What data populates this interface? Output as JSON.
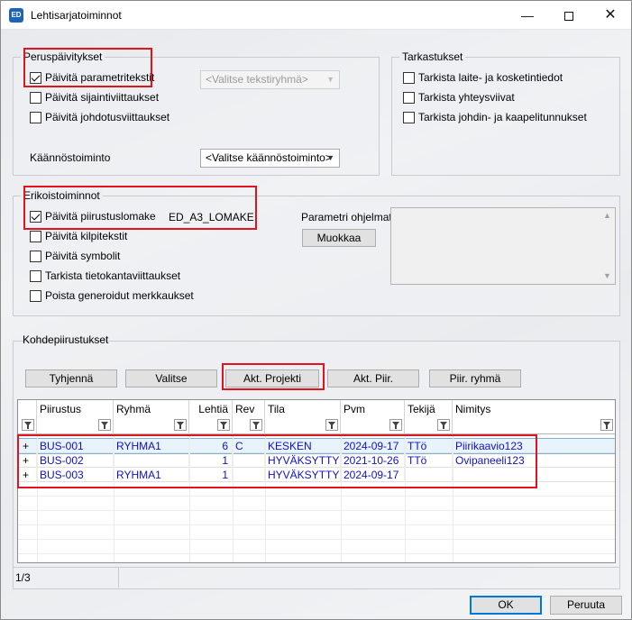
{
  "window": {
    "title": "Lehtisarjatoiminnot",
    "app_icon": "ED",
    "controls": {
      "minimize": "—",
      "close": "✕"
    }
  },
  "basic": {
    "label": "Peruspäivitykset",
    "items": [
      {
        "label": "Päivitä parametritekstit",
        "checked": true
      },
      {
        "label": "Päivitä sijaintiviittaukset",
        "checked": false
      },
      {
        "label": "Päivitä johdotusviittaukset",
        "checked": false
      }
    ],
    "text_group_select": "<Valitse tekstiryhmä>",
    "translation_label": "Käännöstoiminto",
    "translation_select": "<Valitse käännöstoiminto>"
  },
  "checks": {
    "label": "Tarkastukset",
    "items": [
      {
        "label": "Tarkista laite- ja kosketintiedot",
        "checked": false
      },
      {
        "label": "Tarkista yhteysviivat",
        "checked": false
      },
      {
        "label": "Tarkista johdin- ja kaapelitunnukset",
        "checked": false
      }
    ]
  },
  "special": {
    "label": "Erikoistoiminnot",
    "items": [
      {
        "label": "Päivitä piirustuslomake",
        "checked": true
      },
      {
        "label": "Päivitä kilpitekstit",
        "checked": false
      },
      {
        "label": "Päivitä symbolit",
        "checked": false
      },
      {
        "label": "Tarkista tietokantaviittaukset",
        "checked": false
      },
      {
        "label": "Poista generoidut merkkaukset",
        "checked": false
      }
    ],
    "form_name": "ED_A3_LOMAKE",
    "param_programs_label": "Parametri ohjelmat:",
    "edit_button": "Muokkaa"
  },
  "targets": {
    "label": "Kohdepiirustukset",
    "buttons": {
      "clear": "Tyhjennä",
      "select": "Valitse",
      "active_project": "Akt. Projekti",
      "active_drawing": "Akt. Piir.",
      "drawing_group": "Piir. ryhmä"
    },
    "columns": [
      "Piirustus",
      "Ryhmä",
      "Lehtiä",
      "Rev",
      "Tila",
      "Pvm",
      "Tekijä",
      "Nimitys"
    ],
    "rows": [
      {
        "marker": "+",
        "drawing": "BUS-001",
        "group": "RYHMA1",
        "sheets": "6",
        "rev": "C",
        "state": "KESKEN",
        "date": "2024-09-17",
        "author": "TTö",
        "name": "Piirikaavio123"
      },
      {
        "marker": "+",
        "drawing": "BUS-002",
        "group": "",
        "sheets": "1",
        "rev": "",
        "state": "HYVÄKSYTTY",
        "date": "2021-10-26",
        "author": "TTö",
        "name": "Ovipaneeli123"
      },
      {
        "marker": "+",
        "drawing": "BUS-003",
        "group": "RYHMA1",
        "sheets": "1",
        "rev": "",
        "state": "HYVÄKSYTTY",
        "date": "2024-09-17",
        "author": "",
        "name": ""
      }
    ]
  },
  "status": {
    "count": "1/3"
  },
  "footer": {
    "ok": "OK",
    "cancel": "Peruuta"
  },
  "colors": {
    "row_text": "#1010c8",
    "highlight": "#e0141e",
    "primary_border": "#0078d7"
  }
}
